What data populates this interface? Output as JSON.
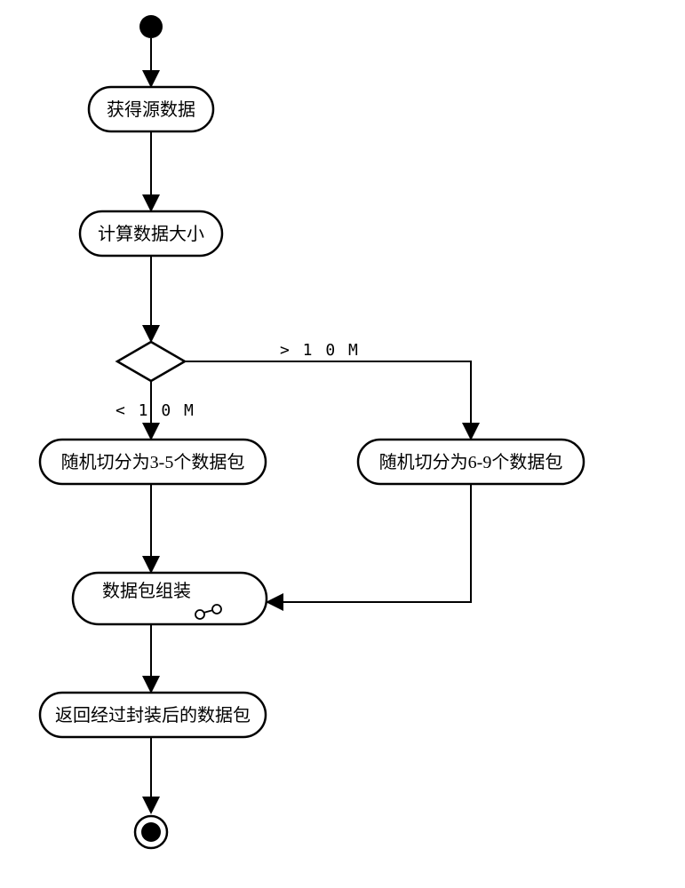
{
  "nodes": {
    "n1": "获得源数据",
    "n2": "计算数据大小",
    "n3": "随机切分为3-5个数据包",
    "n4": "随机切分为6-9个数据包",
    "n5": "数据包组装",
    "n6": "返回经过封装后的数据包"
  },
  "edges": {
    "lt10": "< 1 0 M",
    "gt10": "> 1 0 M"
  },
  "chart_data": {
    "type": "flowchart",
    "title": "",
    "nodes": [
      {
        "id": "start",
        "type": "initial",
        "label": ""
      },
      {
        "id": "n1",
        "type": "activity",
        "label": "获得源数据"
      },
      {
        "id": "n2",
        "type": "activity",
        "label": "计算数据大小"
      },
      {
        "id": "d1",
        "type": "decision",
        "label": ""
      },
      {
        "id": "n3",
        "type": "activity",
        "label": "随机切分为3-5个数据包"
      },
      {
        "id": "n4",
        "type": "activity",
        "label": "随机切分为6-9个数据包"
      },
      {
        "id": "n5",
        "type": "activity",
        "label": "数据包组装",
        "has_stereotype_icon": true
      },
      {
        "id": "n6",
        "type": "activity",
        "label": "返回经过封装后的数据包"
      },
      {
        "id": "end",
        "type": "final",
        "label": ""
      }
    ],
    "edges": [
      {
        "from": "start",
        "to": "n1",
        "label": ""
      },
      {
        "from": "n1",
        "to": "n2",
        "label": ""
      },
      {
        "from": "n2",
        "to": "d1",
        "label": ""
      },
      {
        "from": "d1",
        "to": "n3",
        "label": "< 10M"
      },
      {
        "from": "d1",
        "to": "n4",
        "label": "> 10M"
      },
      {
        "from": "n3",
        "to": "n5",
        "label": ""
      },
      {
        "from": "n4",
        "to": "n5",
        "label": ""
      },
      {
        "from": "n5",
        "to": "n6",
        "label": ""
      },
      {
        "from": "n6",
        "to": "end",
        "label": ""
      }
    ]
  }
}
